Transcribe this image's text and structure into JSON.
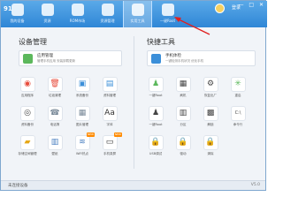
{
  "app": {
    "logo_text": "91"
  },
  "nav": [
    {
      "label": "我的设备",
      "color": "#ffffff"
    },
    {
      "label": "资源",
      "color": "#ffffff"
    },
    {
      "label": "ROM市场",
      "color": "#ffffff"
    },
    {
      "label": "资源管理",
      "color": "#ffffff"
    },
    {
      "label": "实用工具",
      "color": "#ffffff"
    },
    {
      "label": "一键Root",
      "color": "#ffffff"
    }
  ],
  "user": {
    "name": "登录"
  },
  "window_controls": "— □ ✕",
  "left": {
    "title": "设备管理",
    "feature": {
      "title": "应用管理",
      "desc": "管理手机应用 安装卸载更新",
      "icon_color": "#5cb85c"
    },
    "tools": [
      {
        "label": "应用程序",
        "icon": "chrome-icon",
        "glyph": "◉",
        "color": "#e74c3c"
      },
      {
        "label": "垃圾清理",
        "icon": "trash-icon",
        "glyph": "🗑",
        "color": "#e74c3c"
      },
      {
        "label": "系统备份",
        "icon": "backup-icon",
        "glyph": "▣",
        "color": "#3b8fd9"
      },
      {
        "label": "资料管理",
        "icon": "doc-icon",
        "glyph": "▤",
        "color": "#3b8fd9"
      },
      {
        "label": "资料备份",
        "icon": "cd-icon",
        "glyph": "◎",
        "color": "#444444"
      },
      {
        "label": "电话簿",
        "icon": "phone-icon",
        "glyph": "☎",
        "color": "#7a8a99"
      },
      {
        "label": "图片管理",
        "icon": "photo-icon",
        "glyph": "▦",
        "color": "#7a8a99"
      },
      {
        "label": "字体",
        "icon": "font-icon",
        "glyph": "Aa",
        "color": "#333333"
      },
      {
        "label": "存储空间管理",
        "icon": "folder-icon",
        "glyph": "▰",
        "color": "#e6a817"
      },
      {
        "label": "壁纸",
        "icon": "wallpaper-icon",
        "glyph": "▥",
        "color": "#4a7fc0"
      },
      {
        "label": "WiFi热点",
        "icon": "wifi-icon",
        "glyph": "≋",
        "color": "#4a7fc0",
        "badge": "NEW"
      },
      {
        "label": "手机录屏",
        "icon": "record-icon",
        "glyph": "▭",
        "color": "#333333",
        "badge": "NEW"
      }
    ]
  },
  "right": {
    "title": "快捷工具",
    "feature": {
      "title": "手机体检",
      "desc": "一键检测手机状况 优化手机",
      "icon_color": "#3b8fd9"
    },
    "tools": [
      {
        "label": "一键Root",
        "icon": "android-icon",
        "glyph": "♟",
        "color": "#5cb85c"
      },
      {
        "label": "刷机",
        "icon": "flash-icon",
        "glyph": "▦",
        "color": "#444444"
      },
      {
        "label": "恢复出厂",
        "icon": "recovery-icon",
        "glyph": "⚙",
        "color": "#444444"
      },
      {
        "label": "重启",
        "icon": "reboot-icon",
        "glyph": "✳",
        "color": "#5cb85c"
      },
      {
        "label": "一键Root",
        "icon": "android-root-icon",
        "glyph": "♟",
        "color": "#444444"
      },
      {
        "label": "分区",
        "icon": "partition-icon",
        "glyph": "▥",
        "color": "#444444"
      },
      {
        "label": "解锁",
        "icon": "unlock-icon",
        "glyph": "▩",
        "color": "#444444"
      },
      {
        "label": "命令行",
        "icon": "terminal-icon",
        "glyph": "C:\\",
        "color": "#444444"
      },
      {
        "label": "USB调试",
        "icon": "usb-icon",
        "glyph": "🔒",
        "color": "#444444"
      },
      {
        "label": "驱动",
        "icon": "driver-icon",
        "glyph": "🔒",
        "color": "#444444"
      },
      {
        "label": "清除",
        "icon": "clear-icon",
        "glyph": "🔒",
        "color": "#444444"
      }
    ]
  },
  "status": {
    "left": "未连接设备",
    "right": "V5.0"
  }
}
